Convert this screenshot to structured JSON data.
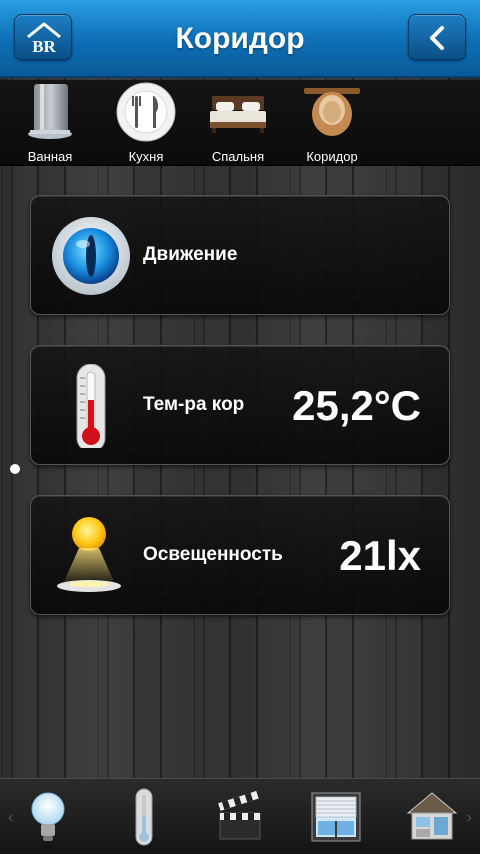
{
  "header": {
    "title": "Коридор",
    "home_icon": "home-logo-icon",
    "back_icon": "chevron-left-icon",
    "accent_color": "#1a7fc8"
  },
  "rooms": [
    {
      "label": "Ванная",
      "icon": "shower-icon"
    },
    {
      "label": "Кухня",
      "icon": "plate-cutlery-icon"
    },
    {
      "label": "Спальня",
      "icon": "bed-icon"
    },
    {
      "label": "Коридор",
      "icon": "hat-hook-icon"
    }
  ],
  "sensors": {
    "motion": {
      "label": "Движение",
      "icon": "eye-sensor-icon"
    },
    "temperature": {
      "label": "Тем-ра кор",
      "value": "25,2°C",
      "icon": "thermometer-icon"
    },
    "illumination": {
      "label": "Освещенность",
      "value": "21lx",
      "icon": "sun-lamp-icon"
    }
  },
  "toolbar": {
    "left_arrow": "‹",
    "right_arrow": "›",
    "items": [
      {
        "icon": "light-bulb-icon"
      },
      {
        "icon": "thermometer-icon"
      },
      {
        "icon": "clapperboard-icon"
      },
      {
        "icon": "window-blinds-icon"
      },
      {
        "icon": "house-rooms-icon"
      }
    ]
  }
}
